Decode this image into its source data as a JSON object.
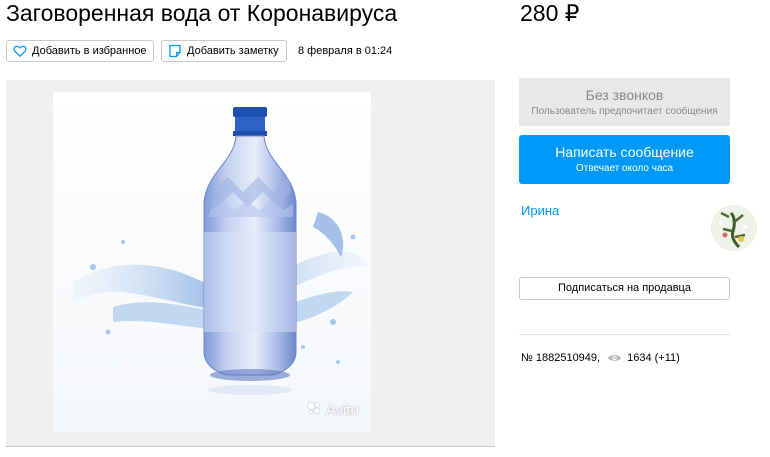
{
  "listing": {
    "title": "Заговоренная вода от Коронавируса",
    "price": "280 ₽",
    "date": "8 февраля в 01:24"
  },
  "actions": {
    "favorite_label": "Добавить в избранное",
    "note_label": "Добавить заметку"
  },
  "gallery": {
    "watermark": "Avito"
  },
  "contact": {
    "no_calls_title": "Без звонков",
    "no_calls_subtitle": "Пользователь предпочитает сообщения",
    "message_button_label": "Написать сообщение",
    "message_button_subtitle": "Отвечает около часа"
  },
  "seller": {
    "name": "Ирина",
    "subscribe_label": "Подписаться на продавца"
  },
  "meta": {
    "item_number": "№ 1882510949,",
    "views": "1634 (+11)"
  },
  "colors": {
    "accent": "#0099f7",
    "muted_panel": "#e8e8e8",
    "border": "#c8c8c8"
  },
  "icons": [
    "heart-icon",
    "note-icon",
    "eye-icon",
    "avito-logo-icon"
  ]
}
